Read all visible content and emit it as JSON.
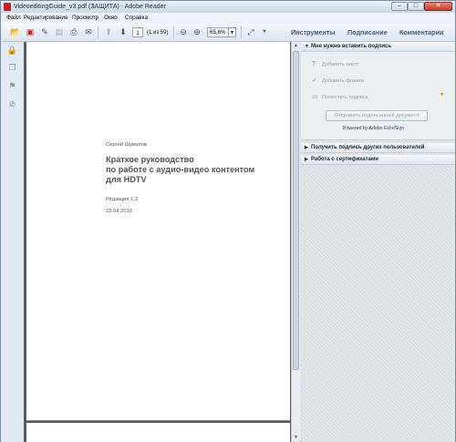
{
  "window": {
    "title": "VideoeditingGuide_v3.pdf (ЗАЩИТА) - Adobe Reader",
    "minimize": "–",
    "maximize": "□",
    "close": "✕"
  },
  "menu": [
    "Файл",
    "Редактирование",
    "Просмотр",
    "Окно",
    "Справка"
  ],
  "toolbar": {
    "page_value": "1",
    "page_count": "(1 из 59)",
    "zoom_value": "65,6%",
    "pane_tools": "Инструменты",
    "pane_sign": "Подписание",
    "pane_comments": "Комментарии"
  },
  "document": {
    "author": "Сергей Шувалов",
    "title_lines": [
      "Краткое руководство",
      "по работе с аудио-видео контентом",
      "для HDTV"
    ],
    "edition": "Редакция 1.2",
    "date": "23.04.2010"
  },
  "sign_panel": {
    "section1_title": "Мне нужно вставить подпись",
    "add_text": "Добавить текст",
    "add_check": "Добавить флажок",
    "place_signature": "Поместить подпись",
    "send_button": "Отправить подписанный документ",
    "powered_prefix": "Powered by Adobe",
    "powered_brand": "EchoSign",
    "section2_title": "Получить подпись других пользователей",
    "section3_title": "Работа с сертификатами"
  },
  "colors": {
    "accent": "#3f5f8a",
    "window_frame": "#7b8ea6",
    "close_button": "#c23a24"
  }
}
